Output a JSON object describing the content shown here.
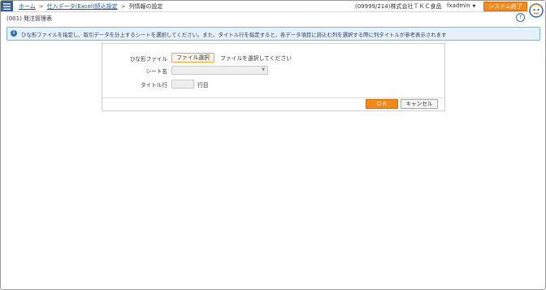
{
  "header": {
    "breadcrumbs": [
      {
        "label": "ホーム"
      },
      {
        "label": "仕入データ(Excel)読込設定"
      },
      {
        "label": "列情報の設定"
      }
    ],
    "company": "(09999/214)株式会社ＴＫＣ食品",
    "user": "fxadmin",
    "exit_label": "システム終了"
  },
  "page": {
    "title": "(001) 発注管理表"
  },
  "info": {
    "message": "ひな形ファイルを指定し、取引データを計上するシートを選択してください。また、タイトル行を指定すると、各データ項目に読込む列を選択する際に列タイトルが参考表示されます"
  },
  "form": {
    "template_label": "ひな形ファイル",
    "file_button": "ファイル選択",
    "file_status": "ファイルを選択してください",
    "sheet_label": "シート名",
    "sheet_value": "",
    "title_row_label": "タイトル行",
    "title_row_value": "",
    "title_row_suffix": "行目",
    "ok_label": "ＯＫ",
    "cancel_label": "キャンセル"
  },
  "colors": {
    "accent": "#f08a1c",
    "header_blue": "#2f5fa7",
    "info_bg": "#e6f1fb"
  }
}
